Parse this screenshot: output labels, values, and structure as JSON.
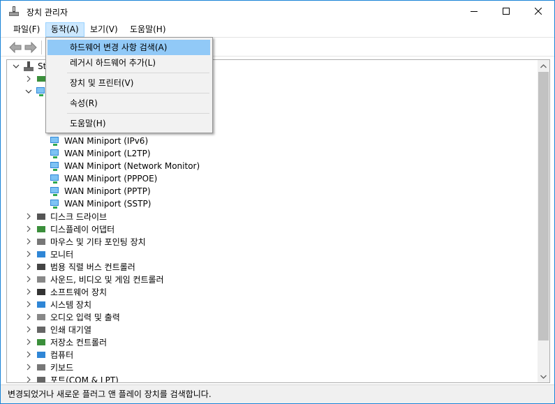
{
  "window": {
    "title": "장치 관리자",
    "accent": "#1883d7",
    "caption_buttons": [
      "minimize-icon",
      "maximize-icon",
      "close-icon"
    ]
  },
  "menubar": {
    "items": [
      {
        "label": "파일(F)"
      },
      {
        "label": "동작(A)",
        "active": true
      },
      {
        "label": "보기(V)"
      },
      {
        "label": "도움말(H)"
      }
    ]
  },
  "toolbar": {
    "buttons": [
      "back-arrow-icon",
      "forward-arrow-icon"
    ]
  },
  "action_menu": {
    "items": [
      {
        "label": "하드웨어 변경 사항 검색(A)",
        "highlighted": true
      },
      {
        "label": "레거시 하드웨어 추가(L)"
      },
      {
        "label": "장치 및 프린터(V)"
      },
      {
        "label": "속성(R)"
      },
      {
        "label": "도움말(H)"
      }
    ]
  },
  "tree": {
    "root_label_partial": "St",
    "network_adapters": [
      "WAN Miniport (IPv6)",
      "WAN Miniport (L2TP)",
      "WAN Miniport (Network Monitor)",
      "WAN Miniport (PPPOE)",
      "WAN Miniport (PPTP)",
      "WAN Miniport (SSTP)"
    ],
    "categories": [
      {
        "label": "디스크 드라이브",
        "icon": "disk-drive-icon"
      },
      {
        "label": "디스플레이 어댑터",
        "icon": "display-adapter-icon"
      },
      {
        "label": "마우스 및 기타 포인팅 장치",
        "icon": "mouse-icon"
      },
      {
        "label": "모니터",
        "icon": "monitor-icon"
      },
      {
        "label": "범용 직렬 버스 컨트롤러",
        "icon": "usb-icon"
      },
      {
        "label": "사운드, 비디오 및 게임 컨트롤러",
        "icon": "speaker-icon"
      },
      {
        "label": "소프트웨어 장치",
        "icon": "software-device-icon"
      },
      {
        "label": "시스템 장치",
        "icon": "system-device-icon"
      },
      {
        "label": "오디오 입력 및 출력",
        "icon": "audio-icon"
      },
      {
        "label": "인쇄 대기열",
        "icon": "printer-icon"
      },
      {
        "label": "저장소 컨트롤러",
        "icon": "storage-controller-icon"
      },
      {
        "label": "컴퓨터",
        "icon": "computer-icon"
      },
      {
        "label": "키보드",
        "icon": "keyboard-icon"
      },
      {
        "label": "포트(COM & LPT)",
        "icon": "port-icon"
      }
    ]
  },
  "statusbar": {
    "text": "변경되었거나 새로운 플러그 앤 플레이 장치를 검색합니다."
  }
}
